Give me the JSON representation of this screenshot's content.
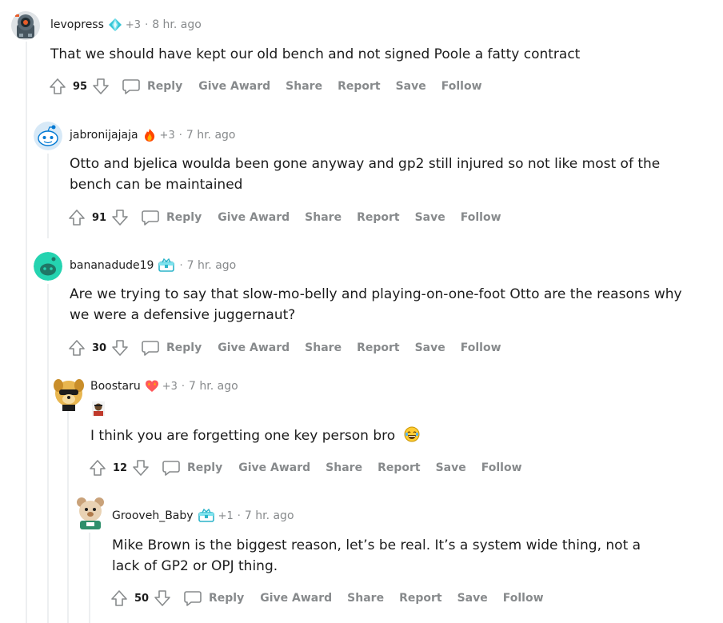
{
  "comments": [
    {
      "username": "levopress",
      "awards": "+3",
      "time": "8 hr. ago",
      "body": "That we should have kept our old bench and not signed Poole a fatty contract",
      "score": "95"
    },
    {
      "username": "jabronijajaja",
      "awards": "+3",
      "time": "7 hr. ago",
      "body": "Otto and bjelica woulda been gone anyway and gp2 still injured so not like most of the bench can be maintained",
      "score": "91"
    },
    {
      "username": "bananadude19",
      "time": "7 hr. ago",
      "body": "Are we trying to say that slow-mo-belly and playing-on-one-foot Otto are the reasons why we were a defensive juggernaut?",
      "score": "30"
    },
    {
      "username": "Boostaru",
      "awards": "+3",
      "time": "7 hr. ago",
      "body": "I think you are forgetting one key person bro",
      "score": "12"
    },
    {
      "username": "Grooveh_Baby",
      "awards": "+1",
      "time": "7 hr. ago",
      "body": "Mike Brown is the biggest reason, let’s be real. It’s a system wide thing, not a lack of GP2 or OPJ thing.",
      "score": "50"
    }
  ],
  "actions": {
    "reply": "Reply",
    "give_award": "Give Award",
    "share": "Share",
    "report": "Report",
    "save": "Save",
    "follow": "Follow"
  },
  "separator": "·",
  "colors": {
    "muted": "#878a8c",
    "text": "#1c1c1c",
    "thread_line": "#edeff1",
    "snoo_blue": "#0079d3",
    "snoo_teal": "#24d3b0"
  }
}
